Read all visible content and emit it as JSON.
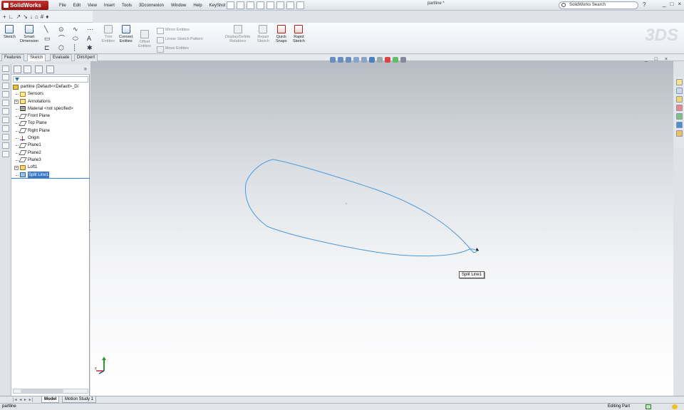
{
  "app": {
    "logo_text": "SolidWorks",
    "document_title": "partline *",
    "search_placeholder": "SolidWorks Search",
    "help_icon": "help-icon",
    "window_controls": [
      "_",
      "□",
      "×"
    ]
  },
  "menu": [
    "File",
    "Edit",
    "View",
    "Insert",
    "Tools",
    "3Dconnexion",
    "Window",
    "Help",
    "KeyShot"
  ],
  "command_manager": {
    "sketch": "Sketch",
    "smart_dimension": [
      "Smart",
      "Dimension"
    ],
    "trim_entities": [
      "Trim",
      "Entities"
    ],
    "convert_entities": [
      "Convert",
      "Entities"
    ],
    "offset_entities": [
      "Offset",
      "Entities"
    ],
    "mirror_entities": "Mirror Entities",
    "linear_sketch_pattern": "Linear Sketch Pattern",
    "move_entities": "Move Entities",
    "display_delete_relations": [
      "Display/Delete",
      "Relations"
    ],
    "repair_sketch": [
      "Repair",
      "Sketch"
    ],
    "quick_snaps": [
      "Quick",
      "Snaps"
    ],
    "rapid_sketch": [
      "Rapid",
      "Sketch"
    ]
  },
  "tabs": [
    "Features",
    "Sketch",
    "Evaluate",
    "DimXpert"
  ],
  "active_tab": "Sketch",
  "feature_tree": {
    "root": "partline  (Default<<Default>_Di",
    "items": [
      {
        "label": "Sensors",
        "icon": "sensor-icon"
      },
      {
        "label": "Annotations",
        "icon": "annotation-icon"
      },
      {
        "label": "Material <not specified>",
        "icon": "material-icon"
      },
      {
        "label": "Front Plane",
        "icon": "plane-icon"
      },
      {
        "label": "Top Plane",
        "icon": "plane-icon"
      },
      {
        "label": "Right Plane",
        "icon": "plane-icon"
      },
      {
        "label": "Origin",
        "icon": "origin-icon"
      },
      {
        "label": "Plane1",
        "icon": "plane-icon"
      },
      {
        "label": "Plane2",
        "icon": "plane-icon"
      },
      {
        "label": "Plane3",
        "icon": "plane-icon"
      },
      {
        "label": "Loft1",
        "icon": "loft-icon"
      },
      {
        "label": "Split Line1",
        "icon": "split-line-icon"
      }
    ]
  },
  "viewport": {
    "tooltip": "Split Line1",
    "curve_color": "#4a9be0"
  },
  "bottom_tabs": [
    "Model",
    "Motion Study 1"
  ],
  "status": {
    "left": "partline",
    "right": "Editing Part"
  }
}
